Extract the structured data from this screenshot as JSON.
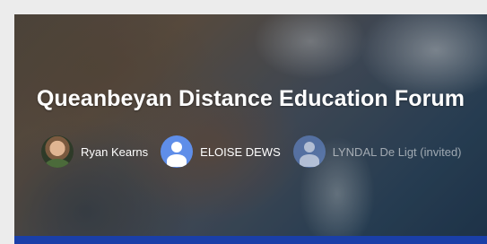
{
  "forum": {
    "title": "Queanbeyan Distance Education Forum"
  },
  "participants": [
    {
      "name": "Ryan Kearns",
      "avatar": "photo"
    },
    {
      "name": "ELOISE DEWS",
      "avatar": "generic-person-icon"
    },
    {
      "name": "LYNDAL De Ligt (invited)",
      "avatar": "generic-person-icon",
      "invited": true
    }
  ],
  "colors": {
    "avatar_blue": "#5f8ee9",
    "bottom_bar": "#1a3fa8"
  }
}
